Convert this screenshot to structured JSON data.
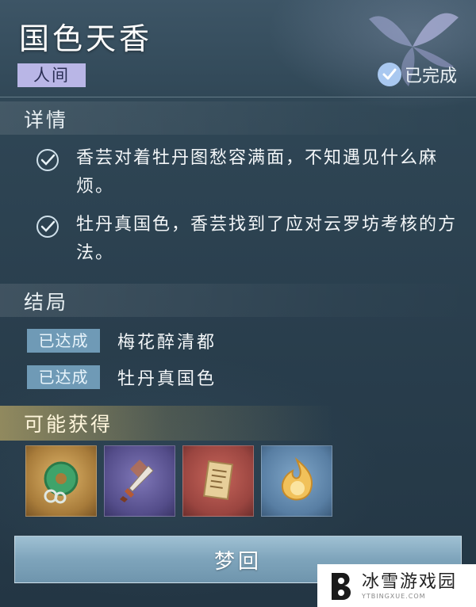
{
  "quest": {
    "title": "国色天香",
    "realm_tag": "人间",
    "status": "已完成"
  },
  "details": {
    "header": "详情",
    "items": [
      {
        "text": "香芸对着牡丹图愁容满面，不知遇见什么麻烦。",
        "done": true
      },
      {
        "text": "牡丹真国色，香芸找到了应对云罗坊考核的方法。",
        "done": true
      }
    ]
  },
  "endings": {
    "header": "结局",
    "items": [
      {
        "badge": "已达成",
        "name": "梅花醉清都"
      },
      {
        "badge": "已达成",
        "name": "牡丹真国色"
      }
    ]
  },
  "rewards": {
    "header": "可能获得",
    "items": [
      {
        "icon": "jade-pendant-icon",
        "rarity": "gold"
      },
      {
        "icon": "dagger-icon",
        "rarity": "purple"
      },
      {
        "icon": "document-icon",
        "rarity": "red"
      },
      {
        "icon": "flame-orb-icon",
        "rarity": "blue"
      }
    ]
  },
  "action": {
    "label": "梦回"
  },
  "watermark": {
    "name": "冰雪游戏园",
    "url": "YTBINGXUE.COM"
  },
  "colors": {
    "background": "#2a3f4e",
    "tag_bg": "#b9b6e6",
    "badge_bg": "#6f9ab6",
    "button_bg": "#7ea4bb",
    "reward_header": "#e6c86e"
  }
}
